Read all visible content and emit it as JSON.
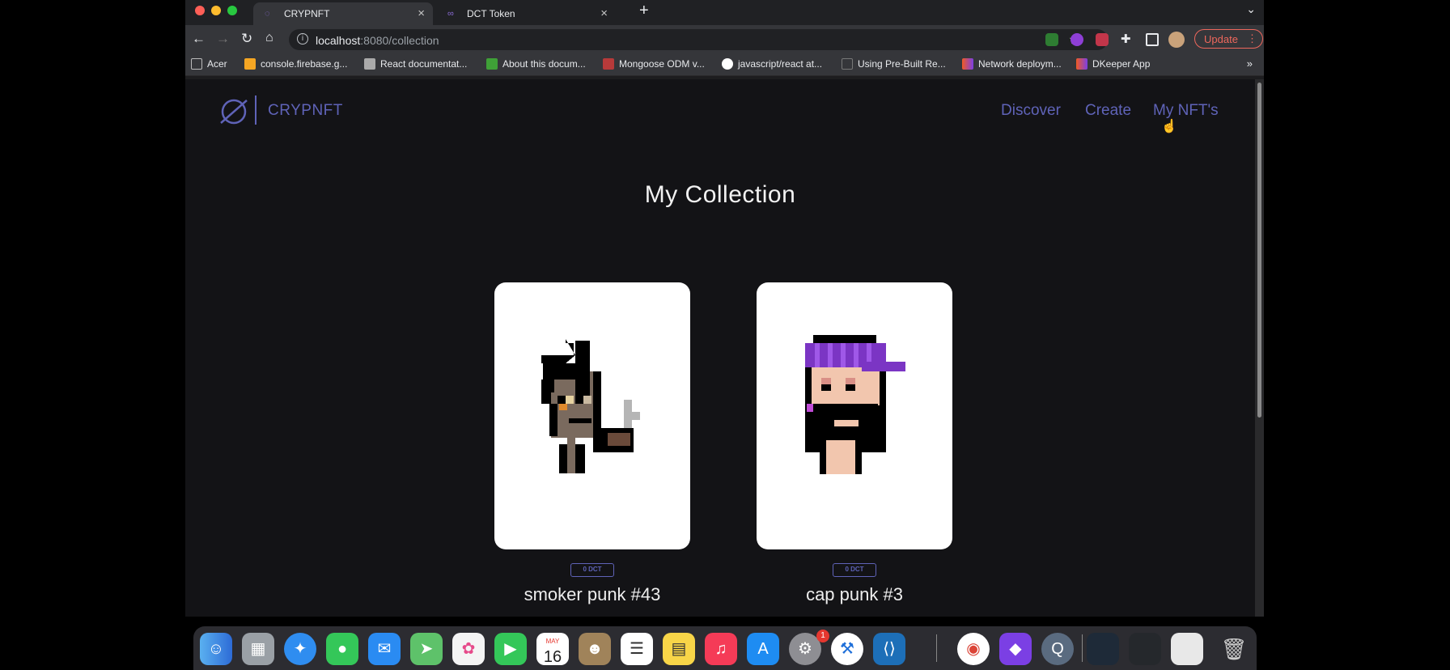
{
  "browser": {
    "tabs": [
      {
        "title": "CRYPNFT",
        "active": true
      },
      {
        "title": "DCT Token",
        "active": false
      }
    ],
    "url_host": "localhost",
    "url_path": ":8080/collection",
    "update_label": "Update",
    "bookmarks": [
      {
        "label": "Acer",
        "icon": "folder-icon"
      },
      {
        "label": "console.firebase.g...",
        "icon": "firebase-icon"
      },
      {
        "label": "React documentat...",
        "icon": "react-icon"
      },
      {
        "label": "About this docum...",
        "icon": "mongo-icon"
      },
      {
        "label": "Mongoose ODM v...",
        "icon": "mongoose-icon"
      },
      {
        "label": "javascript/react at...",
        "icon": "github-icon"
      },
      {
        "label": "Using Pre-Built Re...",
        "icon": "page-icon"
      },
      {
        "label": "Network deploym...",
        "icon": "dfinity-icon"
      },
      {
        "label": "DKeeper App",
        "icon": "dfinity-icon"
      }
    ]
  },
  "site": {
    "brand": "CRYPNFT",
    "nav": {
      "discover": "Discover",
      "create": "Create",
      "my_nfts": "My NFT's"
    },
    "page_title": "My Collection",
    "nfts": [
      {
        "name": "smoker punk #43",
        "price": "0 DCT"
      },
      {
        "name": "cap punk #3",
        "price": "0 DCT"
      }
    ]
  },
  "dock": {
    "apps": [
      "Finder",
      "Launchpad",
      "Safari",
      "Messages",
      "Mail",
      "Maps",
      "Photos",
      "FaceTime",
      "Calendar",
      "Contacts",
      "Reminders",
      "Notes",
      "Music",
      "App Store",
      "System Preferences",
      "Xcode",
      "VS Code",
      "Chrome",
      "GitHub Desktop",
      "QuickTime",
      "Trash"
    ],
    "calendar_month": "MAY",
    "calendar_day": "16",
    "settings_badge": "1"
  },
  "colors": {
    "accent": "#5f63b8",
    "page_bg": "#131316",
    "update": "#ee675c"
  }
}
